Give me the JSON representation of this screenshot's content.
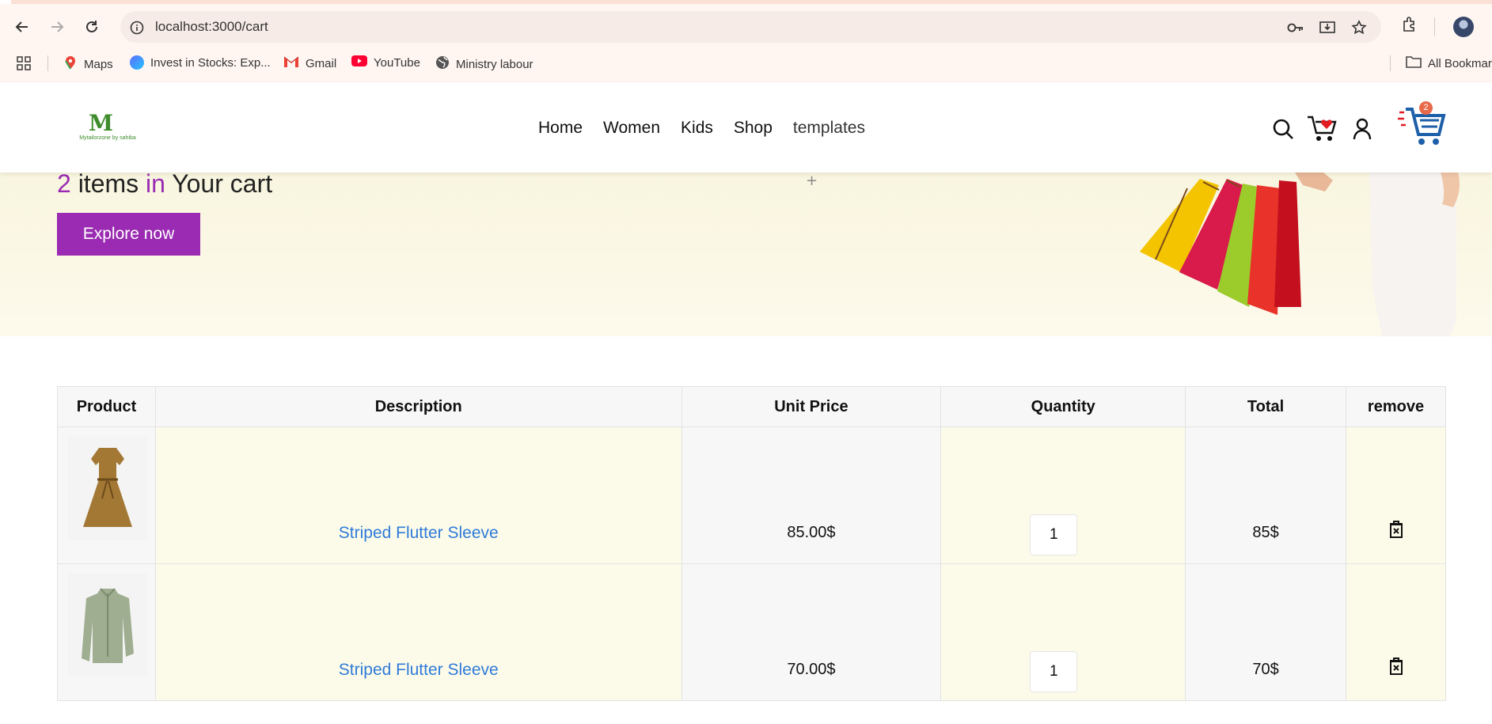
{
  "browser": {
    "url": "localhost:3000/cart",
    "bookmarks": [
      {
        "label": "Maps",
        "icon": "maps-icon"
      },
      {
        "label": "Invest in Stocks: Exp...",
        "icon": "invest-icon"
      },
      {
        "label": "Gmail",
        "icon": "gmail-icon"
      },
      {
        "label": "YouTube",
        "icon": "youtube-icon"
      },
      {
        "label": "Ministry labour",
        "icon": "globe-icon"
      }
    ],
    "all_bookmarks": "All Bookmar"
  },
  "site": {
    "logo_letter": "M",
    "logo_sub": "Mytailorzone by sahiba",
    "nav": [
      "Home",
      "Women",
      "Kids",
      "Shop",
      "templates"
    ],
    "cart_count": "2"
  },
  "hero": {
    "count": "2",
    "word_items": "items",
    "word_in": "in",
    "word_cart": "Your cart",
    "button": "Explore now",
    "plus": "+"
  },
  "table": {
    "headers": [
      "Product",
      "Description",
      "Unit Price",
      "Quantity",
      "Total",
      "remove"
    ],
    "rows": [
      {
        "image": "brown-dress",
        "description": "Striped Flutter Sleeve",
        "unit_price": "85.00$",
        "quantity": "1",
        "total": "85$"
      },
      {
        "image": "green-shirt",
        "description": "Striped Flutter Sleeve",
        "unit_price": "70.00$",
        "quantity": "1",
        "total": "70$"
      }
    ]
  },
  "colors": {
    "accent": "#9a2bb2",
    "link": "#2f7bd9",
    "badge": "#e86a4a"
  }
}
